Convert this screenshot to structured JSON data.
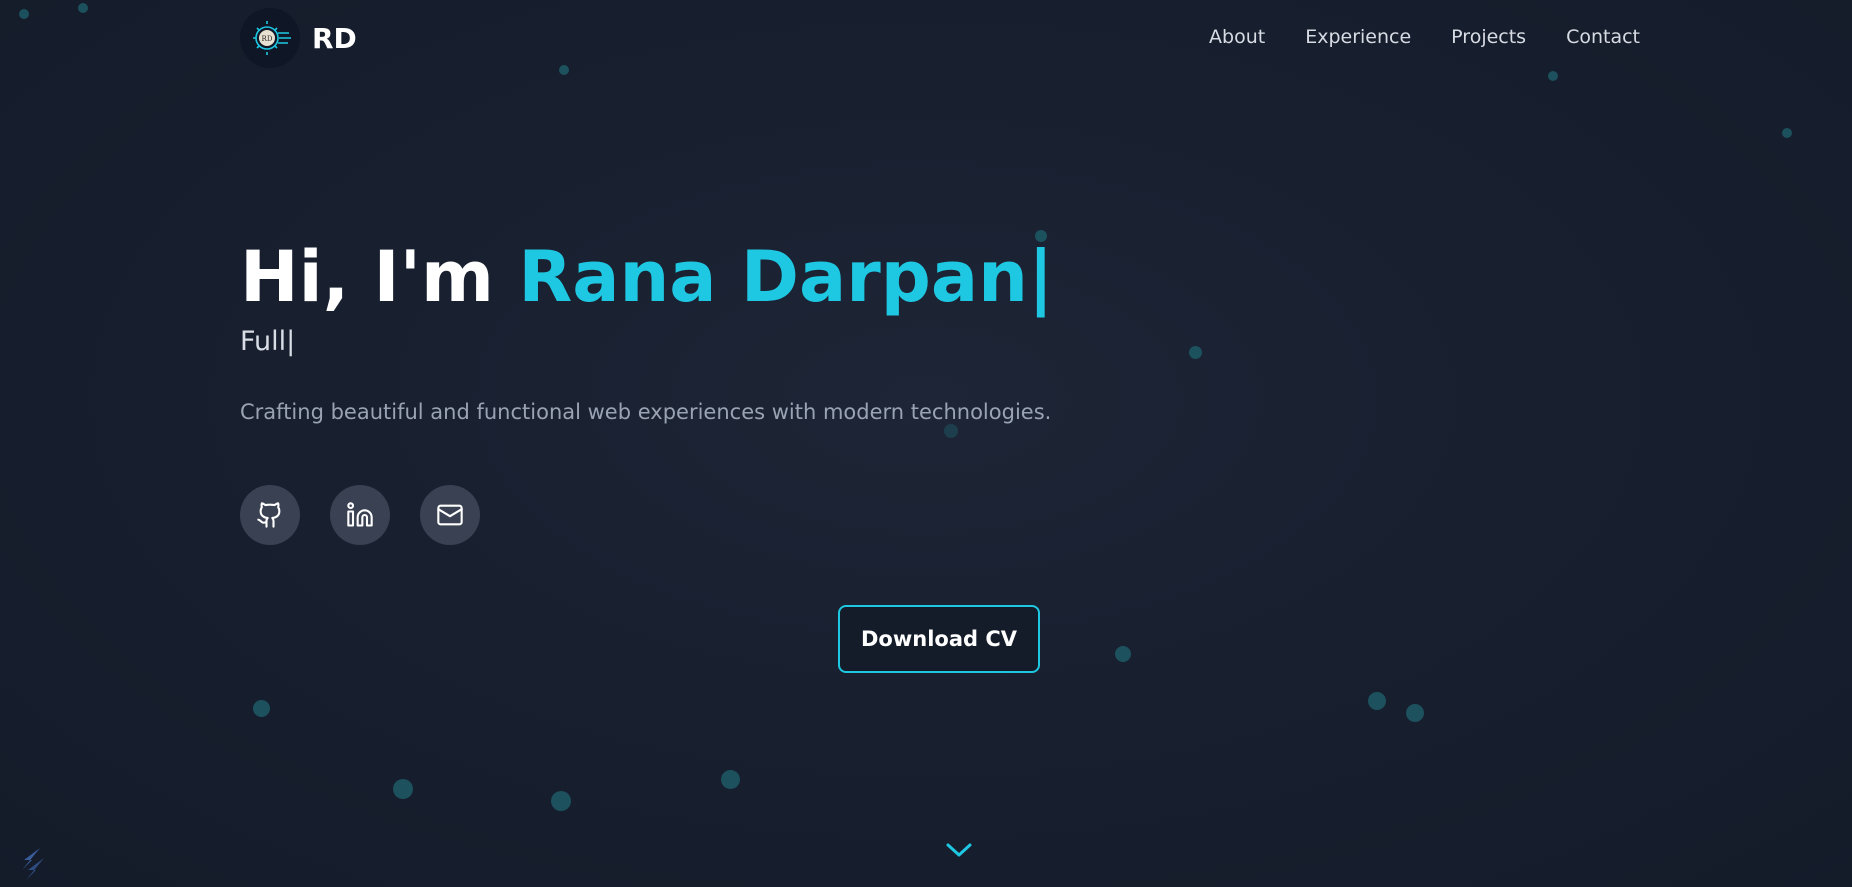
{
  "brand": {
    "logo_icon": "gear-circuit-logo",
    "logo_text": "RD",
    "name": "RD"
  },
  "nav": {
    "items": [
      "About",
      "Experience",
      "Projects",
      "Contact"
    ]
  },
  "hero": {
    "greeting": "Hi, I'm ",
    "name": "Rana Darpan|",
    "role_typing": "Full|",
    "tagline": "Crafting beautiful and functional web experiences with modern technologies."
  },
  "socials": [
    {
      "icon": "github-icon"
    },
    {
      "icon": "linkedin-icon"
    },
    {
      "icon": "mail-icon"
    }
  ],
  "cta": {
    "label": "Download CV"
  },
  "scroll": {
    "icon": "chevron-down-icon"
  },
  "colors": {
    "background": "#182030",
    "accent": "#1ec8e2",
    "social_bg": "#394152",
    "particle": "#1d5763"
  }
}
